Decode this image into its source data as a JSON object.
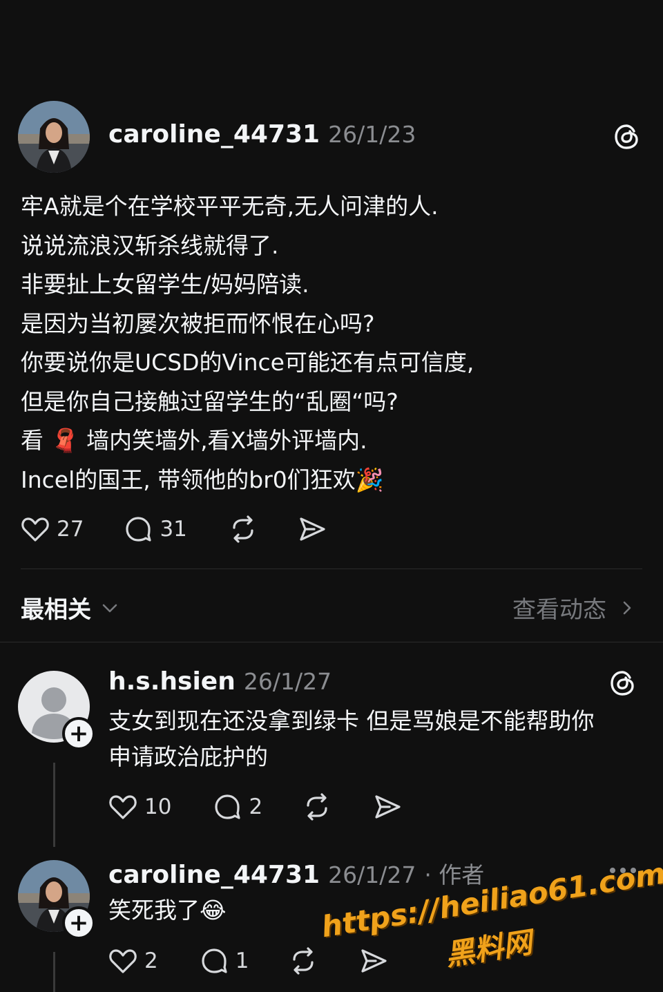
{
  "post": {
    "username": "caroline_44731",
    "time": "26/1/23",
    "lines": [
      "牢A就是个在学校平平无奇,无人问津的人.",
      "说说流浪汉斩杀线就得了.",
      "非要扯上女留学生/妈妈陪读.",
      "是因为当初屡次被拒而怀恨在心吗?",
      "你要说你是UCSD的Vince可能还有点可信度,",
      "但是你自己接触过留学生的“乱圈“吗?",
      "看 🧣 墙内笑墙外,看X墙外评墙内.",
      "Incel的国王, 带领他的br0们狂欢🎉"
    ],
    "likes": "27",
    "replies": "31"
  },
  "sort_bar": {
    "label": "最相关",
    "view_activity": "查看动态"
  },
  "comments": [
    {
      "username": "h.s.hsien",
      "time": "26/1/27",
      "lines": [
        "支女到现在还没拿到绿卡 但是骂娘是不能帮助你",
        "申请政治庇护的"
      ],
      "likes": "10",
      "replies": "2"
    },
    {
      "username": "caroline_44731",
      "time": "26/1/27",
      "author_tag": "· 作者",
      "text": "笑死我了😂",
      "likes": "2",
      "replies": "1"
    }
  ],
  "watermark": {
    "url": "https://heiliao61.com",
    "site": "黑料网"
  },
  "icons": [
    "threads-logo-icon",
    "heart-icon",
    "comment-icon",
    "repost-icon",
    "share-icon",
    "chevron-down-icon",
    "chevron-right-icon",
    "more-icon",
    "plus-icon",
    "default-avatar-icon"
  ],
  "colors": {
    "background": "#101010",
    "text": "#f3f5f7",
    "muted": "#8b8d91",
    "watermark": "#f0a21b"
  }
}
